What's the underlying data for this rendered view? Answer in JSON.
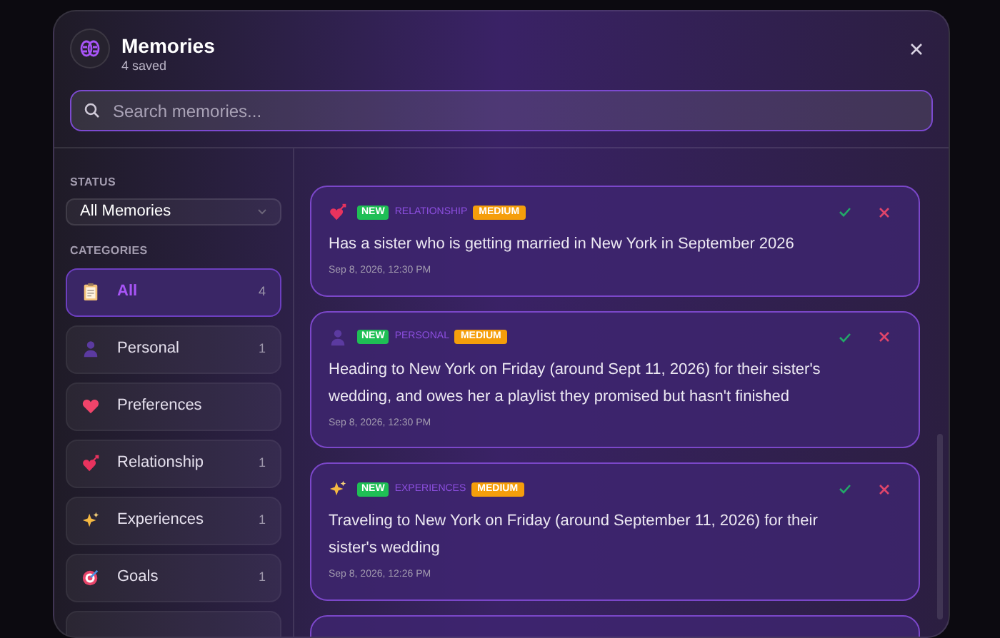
{
  "header": {
    "title": "Memories",
    "subtitle": "4 saved"
  },
  "search": {
    "placeholder": "Search memories..."
  },
  "sidebar": {
    "status_label": "STATUS",
    "status_select": "All Memories",
    "categories_label": "CATEGORIES",
    "categories": [
      {
        "kind": "clipboard",
        "label": "All",
        "count": "4",
        "selected": true
      },
      {
        "kind": "person",
        "label": "Personal",
        "count": "1",
        "selected": false
      },
      {
        "kind": "heart",
        "label": "Preferences",
        "selected": false
      },
      {
        "kind": "heart-arrow",
        "label": "Relationship",
        "count": "1",
        "selected": false
      },
      {
        "kind": "sparkles",
        "label": "Experiences",
        "count": "1",
        "selected": false
      },
      {
        "kind": "target",
        "label": "Goals",
        "count": "1",
        "selected": false
      }
    ],
    "more_below": true
  },
  "memories": [
    {
      "kind": "heart-arrow",
      "status": "NEW",
      "category": "RELATIONSHIP",
      "importance": "MEDIUM",
      "text": "Has a sister who is getting married in New York in September 2026",
      "date": "Sep 8, 2026, 12:30 PM"
    },
    {
      "kind": "person",
      "status": "NEW",
      "category": "PERSONAL",
      "importance": "MEDIUM",
      "text": "Heading to New York on Friday (around Sept 11, 2026) for their sister's wedding, and owes her a playlist they promised but hasn't finished",
      "date": "Sep 8, 2026, 12:30 PM"
    },
    {
      "kind": "sparkles",
      "status": "NEW",
      "category": "EXPERIENCES",
      "importance": "MEDIUM",
      "text": "Traveling to New York on Friday (around September 11, 2026) for their sister's wedding",
      "date": "Sep 8, 2026, 12:26 PM"
    }
  ],
  "more_memories_below": true
}
